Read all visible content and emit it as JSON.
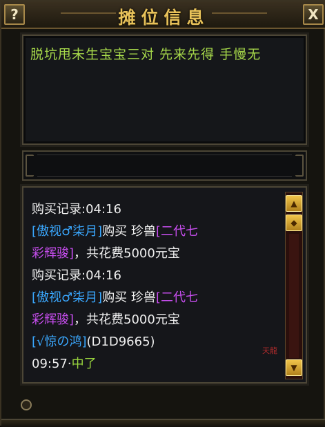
{
  "window": {
    "title": "摊位信息",
    "help_label": "?",
    "close_label": "X"
  },
  "message": {
    "text": "脱坑甩未生宝宝三对 先来先得 手慢无"
  },
  "log": {
    "entries": [
      {
        "type": "header",
        "label": "购买记录:04:16"
      },
      {
        "type": "purchase",
        "buyer": "[傲视♂柒月]",
        "verb": "购买 珍兽",
        "item1": "[二代七",
        "item2": "彩辉骏]",
        "cost": "，共花费5000元宝"
      },
      {
        "type": "header",
        "label": "购买记录:04:16"
      },
      {
        "type": "purchase",
        "buyer": "[傲视♂柒月]",
        "verb": "购买 珍兽",
        "item1": "[二代七",
        "item2": "彩辉骏]",
        "cost": "，共花费5000元宝"
      },
      {
        "type": "chat",
        "name": "[√惊の鸿]",
        "code": "(D1D9665)"
      },
      {
        "type": "time",
        "time": "09:57·",
        "text": "中了"
      }
    ]
  },
  "scrollbar": {
    "up_icon": "arrow-up-icon",
    "thumb_icon": "diamond-icon",
    "down_icon": "arrow-down-icon"
  },
  "watermark": "天龍"
}
